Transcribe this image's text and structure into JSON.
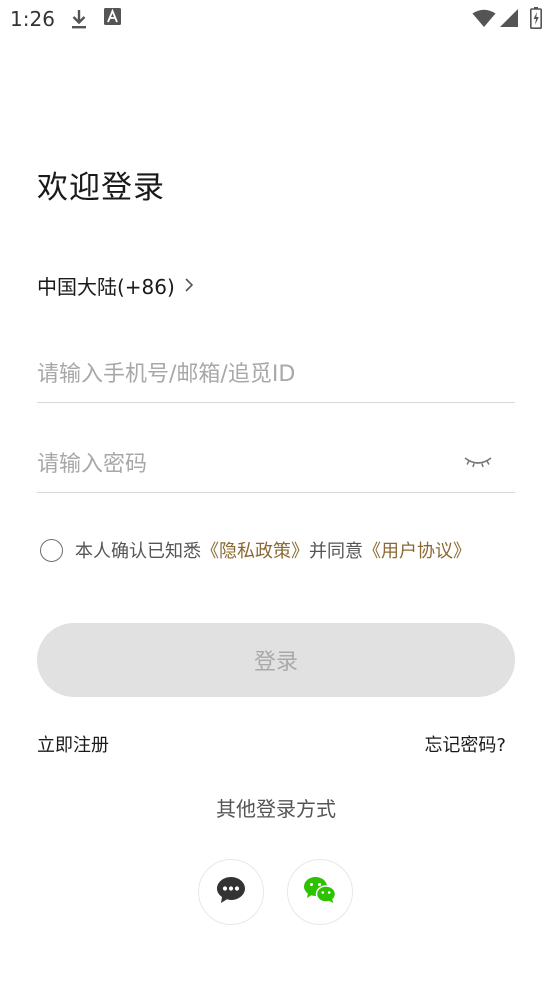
{
  "status_bar": {
    "time": "1:26",
    "icons": [
      "download-icon",
      "a-icon",
      "wifi-icon",
      "signal-icon",
      "battery-icon"
    ]
  },
  "login": {
    "title": "欢迎登录",
    "region_label": "中国大陆(+86)",
    "account_placeholder": "请输入手机号/邮箱/追觅ID",
    "password_placeholder": "请输入密码",
    "agreement": {
      "prefix": "本人确认已知悉",
      "privacy_link": "《隐私政策》",
      "middle": "并同意",
      "terms_link": "《用户协议》"
    },
    "submit_label": "登录",
    "register_label": "立即注册",
    "forgot_label": "忘记密码?",
    "other_methods_title": "其他登录方式"
  },
  "colors": {
    "link": "#8a6a32",
    "button_bg": "#e1e1e1",
    "button_text": "#a9a9a9",
    "wechat_green": "#2dc100"
  }
}
